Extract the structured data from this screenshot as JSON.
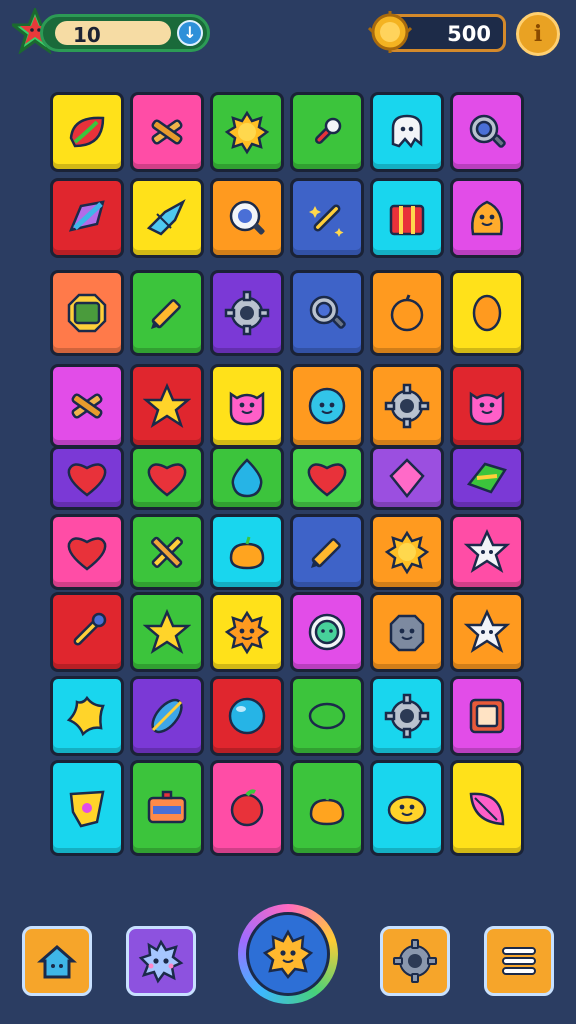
{
  "hud": {
    "level_value": "10",
    "coins_value": "500",
    "level_button_icon": "down-arrow-icon",
    "info_button_icon": "info-icon"
  },
  "colors": {
    "background": "#2b3d62",
    "red": "#e0262e",
    "pink": "#ff4da6",
    "yellow": "#ffe11a",
    "green": "#3cc43c",
    "cyan": "#19d6ee",
    "magenta": "#e24de8",
    "orange": "#ff9a1f",
    "blue": "#3e63c8",
    "purple": "#7b39d6",
    "lilac": "#9b4fe0",
    "salmon": "#ff7a4a",
    "lime": "#47d14a"
  },
  "board": {
    "rows": [
      [
        {
          "color": "yellow",
          "icon": "leaf-icon"
        },
        {
          "color": "pink",
          "icon": "crossed-sticks-icon"
        },
        {
          "color": "green",
          "icon": "sun-icon"
        },
        {
          "color": "green",
          "icon": "key-icon"
        },
        {
          "color": "cyan",
          "icon": "ghost-icon"
        },
        {
          "color": "magenta",
          "icon": "magnifier-icon"
        }
      ],
      [
        {
          "color": "red",
          "icon": "crystal-icon"
        },
        {
          "color": "yellow",
          "icon": "bird-icon"
        },
        {
          "color": "orange",
          "icon": "search-lens-icon"
        },
        {
          "color": "blue",
          "icon": "wand-icon"
        },
        {
          "color": "cyan",
          "icon": "gift-box-icon"
        },
        {
          "color": "magenta",
          "icon": "blob-creature-icon"
        }
      ],
      [
        {
          "color": "salmon",
          "icon": "emblem-icon"
        },
        {
          "color": "green",
          "icon": "pencil-icon"
        },
        {
          "color": "purple",
          "icon": "gear-icon"
        },
        {
          "color": "blue",
          "icon": "magnifier-icon"
        },
        {
          "color": "orange",
          "icon": "orange-fruit-icon"
        },
        {
          "color": "yellow",
          "icon": "seed-icon"
        }
      ],
      [
        {
          "color": "magenta",
          "icon": "crossed-sticks-icon"
        },
        {
          "color": "red",
          "icon": "star-icon"
        },
        {
          "color": "yellow",
          "icon": "cat-face-icon"
        },
        {
          "color": "orange",
          "icon": "smiley-icon"
        },
        {
          "color": "orange",
          "icon": "gear-icon"
        },
        {
          "color": "red",
          "icon": "cat-face-icon"
        }
      ],
      [
        {
          "color": "purple",
          "icon": "heart-icon"
        },
        {
          "color": "green",
          "icon": "heart-icon"
        },
        {
          "color": "green",
          "icon": "droplet-icon"
        },
        {
          "color": "lime",
          "icon": "heart-icon"
        },
        {
          "color": "lilac",
          "icon": "gem-icon"
        },
        {
          "color": "purple",
          "icon": "folded-paper-icon"
        }
      ],
      [
        {
          "color": "pink",
          "icon": "heart-icon"
        },
        {
          "color": "green",
          "icon": "crossed-pencils-icon"
        },
        {
          "color": "cyan",
          "icon": "squash-icon"
        },
        {
          "color": "blue",
          "icon": "pencil-icon"
        },
        {
          "color": "orange",
          "icon": "sun-icon"
        },
        {
          "color": "pink",
          "icon": "star-creature-icon"
        }
      ],
      [
        {
          "color": "red",
          "icon": "brush-icon"
        },
        {
          "color": "green",
          "icon": "star-icon"
        },
        {
          "color": "yellow",
          "icon": "sun-creature-icon"
        },
        {
          "color": "magenta",
          "icon": "ring-face-icon"
        },
        {
          "color": "orange",
          "icon": "rock-creature-icon"
        },
        {
          "color": "orange",
          "icon": "star-creature-icon"
        }
      ],
      [
        {
          "color": "cyan",
          "icon": "star-blob-icon"
        },
        {
          "color": "purple",
          "icon": "feather-icon"
        },
        {
          "color": "red",
          "icon": "bubble-icon"
        },
        {
          "color": "green",
          "icon": "bean-icon"
        },
        {
          "color": "cyan",
          "icon": "gear-icon"
        },
        {
          "color": "magenta",
          "icon": "card-icon"
        }
      ],
      [
        {
          "color": "cyan",
          "icon": "badge-icon"
        },
        {
          "color": "green",
          "icon": "robot-icon"
        },
        {
          "color": "pink",
          "icon": "apple-icon"
        },
        {
          "color": "green",
          "icon": "squash-icon"
        },
        {
          "color": "cyan",
          "icon": "bun-icon"
        },
        {
          "color": "yellow",
          "icon": "pink-leaf-icon"
        }
      ]
    ]
  },
  "bottom_bar": {
    "home": {
      "icon": "home-icon",
      "color": "#f6a52a"
    },
    "powerup": {
      "icon": "monster-icon",
      "color": "#8d52df"
    },
    "center": {
      "icon": "sun-creature-icon",
      "color": "#2d6fd6"
    },
    "settings": {
      "icon": "gear-icon",
      "color": "#f6a52a"
    },
    "menu": {
      "icon": "menu-icon",
      "color": "#f6a52a"
    }
  }
}
